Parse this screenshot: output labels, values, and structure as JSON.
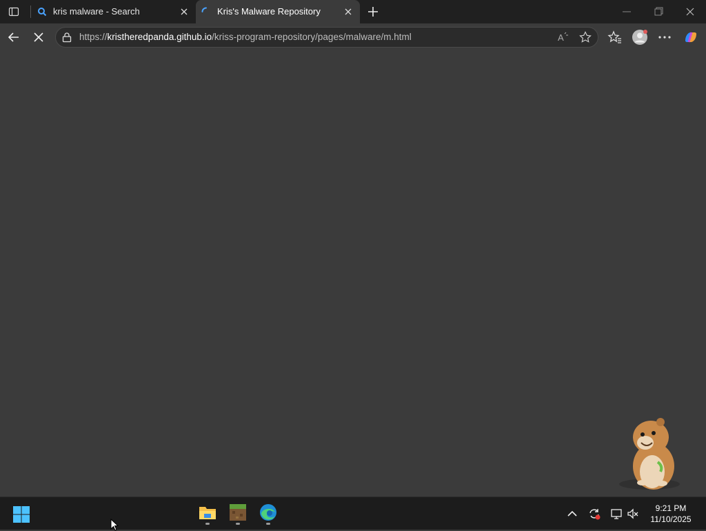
{
  "tabs": [
    {
      "title": "kris malware - Search",
      "state": "inactive",
      "favicon": "search-icon"
    },
    {
      "title": "Kris's Malware Repository",
      "state": "active-loading",
      "favicon": "loading-spinner-icon"
    }
  ],
  "address_bar": {
    "url_prefix": "https://",
    "url_host": "kristheredpanda.github.io",
    "url_path": "/kriss-program-repository/pages/malware/m.html"
  },
  "toolbar_icons": [
    "back-arrow-icon",
    "stop-loading-icon",
    "read-aloud-icon",
    "favorite-star-icon",
    "favorites-icon",
    "profile-avatar-icon",
    "more-menu-icon",
    "copilot-icon"
  ],
  "page": {
    "background": "#3b3b3b",
    "overlay": "hamster-image"
  },
  "taskbar": {
    "apps": [
      "file-explorer-icon",
      "minecraft-icon",
      "edge-icon"
    ],
    "tray_icons": [
      "show-hidden-icons-chevron",
      "sync-icon",
      "display-icon",
      "volume-muted-icon"
    ],
    "time": "9:21 PM",
    "date": "11/10/2025"
  },
  "colors": {
    "accent": "#4aa3ff",
    "chrome_dark": "#202020",
    "taskbar": "#1c1c1c"
  }
}
